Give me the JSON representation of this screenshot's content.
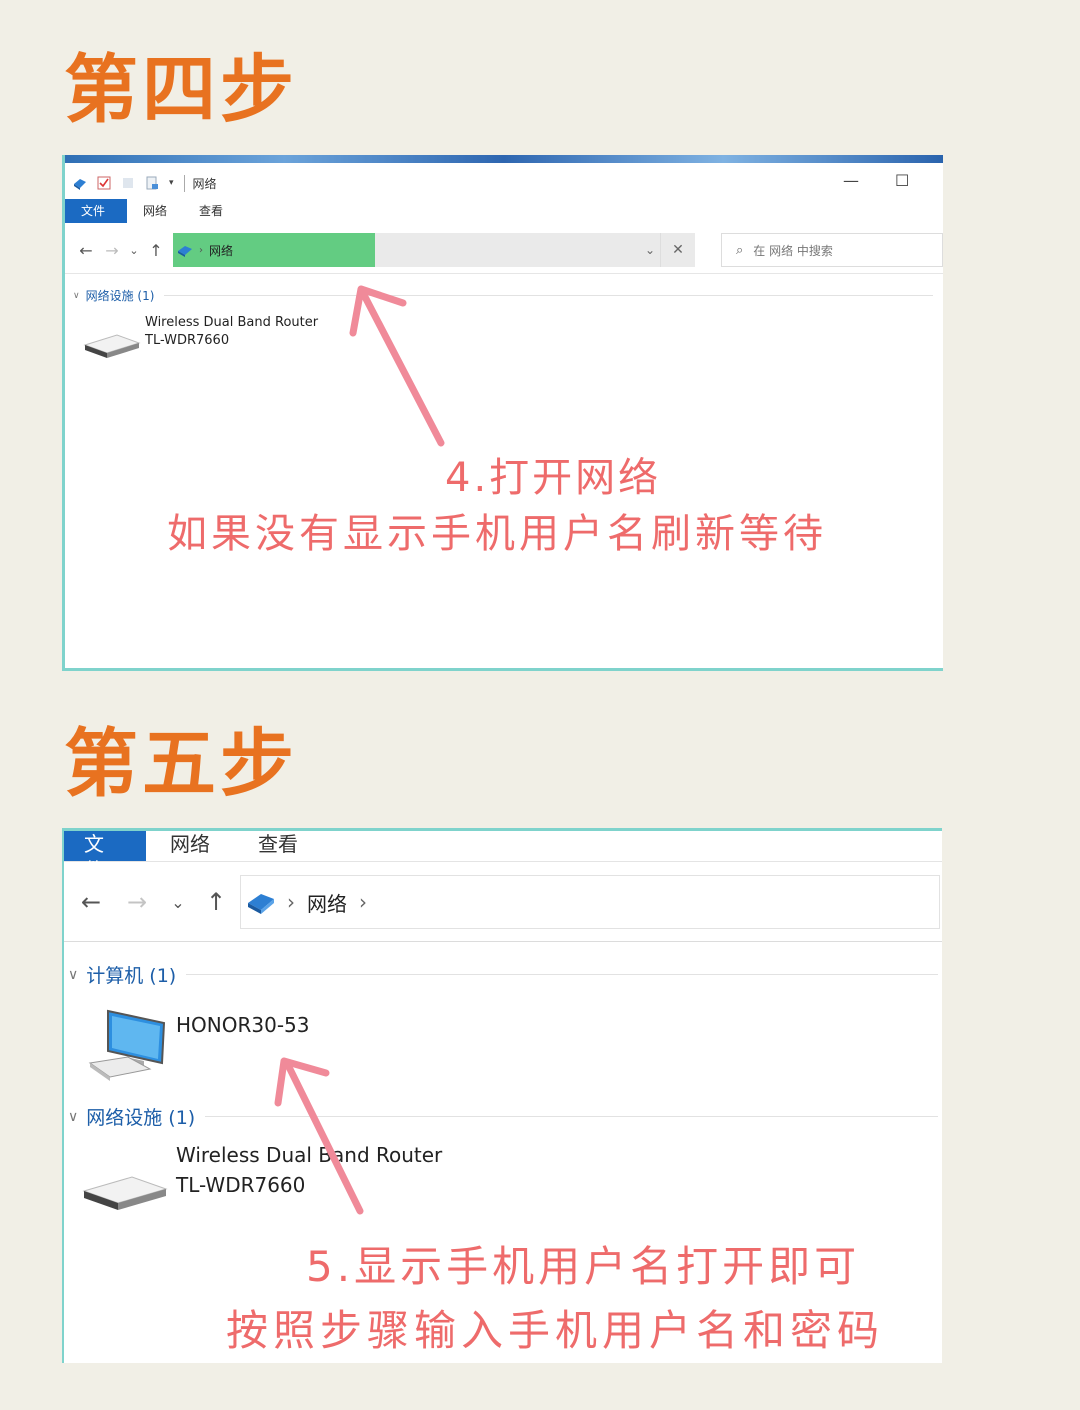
{
  "step4": {
    "title": "第四步",
    "window_title": "网络",
    "tabs": [
      "文件",
      "网络",
      "查看"
    ],
    "breadcrumb": "网络",
    "search_placeholder": "在 网络 中搜索",
    "group_label": "网络设施 (1)",
    "device_line1": "Wireless Dual Band Router",
    "device_line2": "TL-WDR7660",
    "annotation_line1": "4.打开网络",
    "annotation_line2": "如果没有显示手机用户名刷新等待"
  },
  "step5": {
    "title": "第五步",
    "tabs": [
      "文件",
      "网络",
      "查看"
    ],
    "breadcrumb": "网络",
    "group1_label": "计算机 (1)",
    "computer_name": "HONOR30-53",
    "group2_label": "网络设施 (1)",
    "device_line1": "Wireless Dual Band Router",
    "device_line2": "TL-WDR7660",
    "annotation_line1": "5.显示手机用户名打开即可",
    "annotation_line2": "按照步骤输入手机用户名和密码"
  },
  "colors": {
    "title_orange": "#e87220",
    "annotation_pink": "#ee6b6b",
    "ribbon_blue": "#1b6ac2",
    "highlight_green": "#63cc82",
    "frame_teal": "#7fd3cc"
  },
  "icons": [
    "network-icon",
    "checkbox-icon",
    "folder-icon",
    "back-arrow-icon",
    "forward-arrow-icon",
    "chevron-down-icon",
    "up-arrow-icon",
    "close-icon",
    "search-icon",
    "router-icon",
    "computer-icon",
    "minimize-icon",
    "maximize-icon"
  ]
}
